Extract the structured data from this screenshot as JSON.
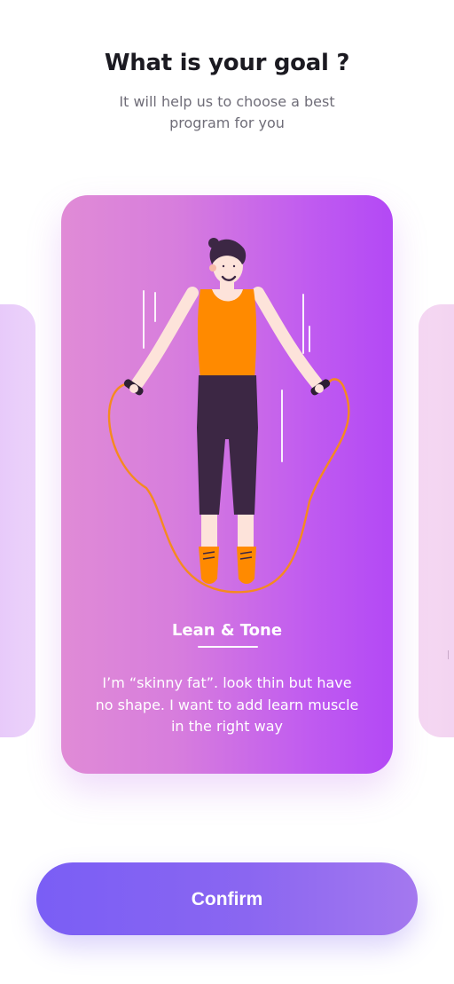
{
  "header": {
    "title": "What is your goal ?",
    "subtitle": "It will help us to choose a best program for you"
  },
  "carousel": {
    "active_card": {
      "title": "Lean & Tone",
      "description": "I’m “skinny fat”. look thin but have no shape. I want to add learn muscle in the right way",
      "illustration": "person-jumping-rope"
    }
  },
  "footer": {
    "confirm_label": "Confirm"
  },
  "colors": {
    "title": "#1b1a21",
    "subtitle": "#6f6d78",
    "card_gradient_start": "#e08bd6",
    "card_gradient_end": "#b349f5",
    "button_gradient_start": "#7a5ef5",
    "button_gradient_end": "#a478ef",
    "rope": "#f58a1f",
    "tank_top": "#ff8a00",
    "pants": "#3c2744"
  }
}
